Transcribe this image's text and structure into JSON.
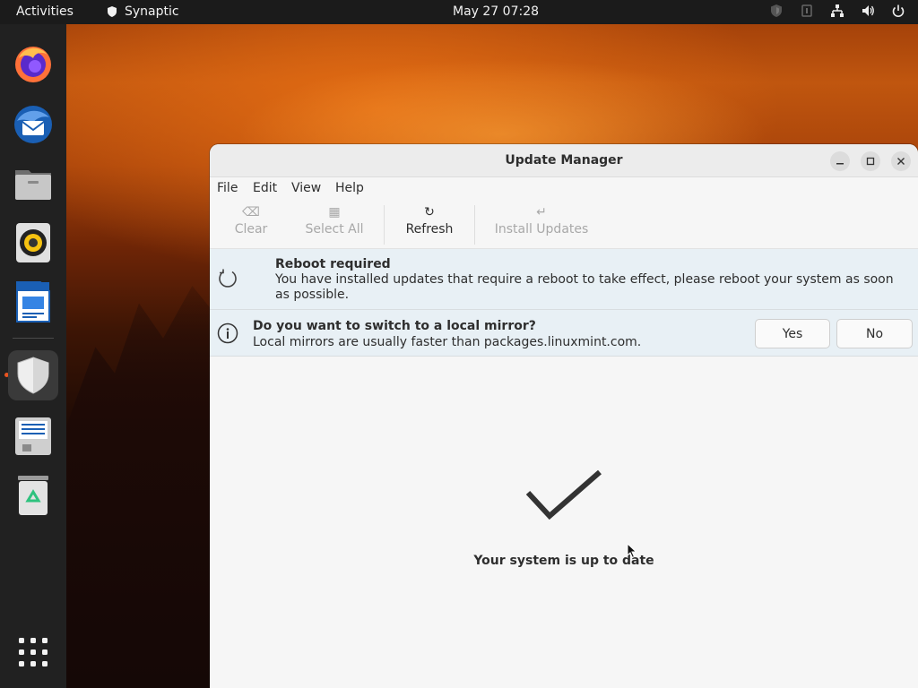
{
  "topbar": {
    "activities": "Activities",
    "app_name": "Synaptic",
    "clock": "May 27  07:28"
  },
  "dock": {
    "items": [
      "firefox-icon",
      "thunderbird-icon",
      "files-icon",
      "rhythmbox-icon",
      "writer-icon",
      "update-manager-icon",
      "storage-icon",
      "trash-icon"
    ],
    "apps_grid": "apps-grid-icon"
  },
  "window": {
    "title": "Update Manager",
    "menu": [
      "File",
      "Edit",
      "View",
      "Help"
    ],
    "toolbar": {
      "clear": "Clear",
      "select_all": "Select All",
      "refresh": "Refresh",
      "install_updates": "Install Updates"
    },
    "reboot_bar": {
      "title": "Reboot required",
      "text": "You have installed updates that require a reboot to take effect, please reboot your system as soon as possible."
    },
    "mirror_bar": {
      "title": "Do you want to switch to a local mirror?",
      "text": "Local mirrors are usually faster than packages.linuxmint.com.",
      "yes": "Yes",
      "no": "No"
    },
    "status": "Your system is up to date"
  },
  "colors": {
    "accent": "#e95420",
    "infobar": "#e8f0f5"
  }
}
